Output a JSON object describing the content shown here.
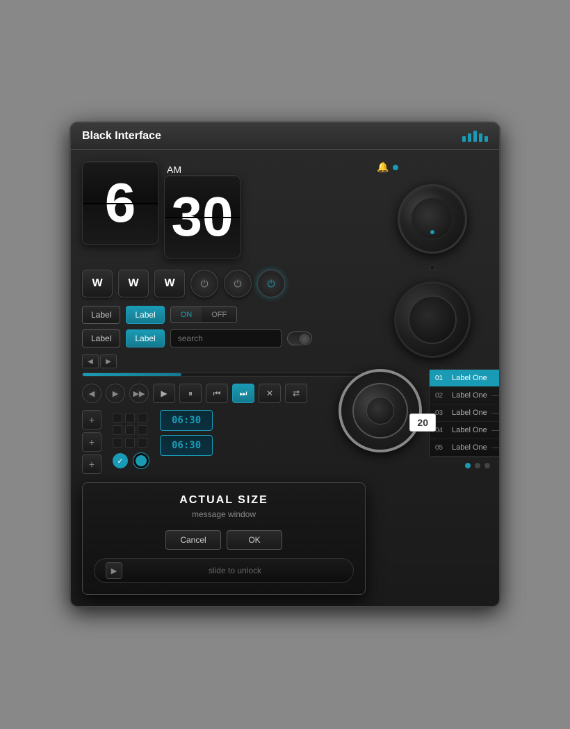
{
  "device": {
    "title": "Black Interface",
    "title_bars": [
      1,
      2,
      3,
      4,
      5
    ]
  },
  "clock": {
    "hour": "6",
    "minute": "30",
    "period": "AM"
  },
  "w_buttons": [
    "W",
    "W",
    "W"
  ],
  "power_buttons": [
    "⏻",
    "⏻",
    "⏻"
  ],
  "labels": {
    "label1": "Label",
    "label2": "Label",
    "label3": "Label",
    "label4": "Label"
  },
  "toggle": {
    "on": "ON",
    "off": "OFF"
  },
  "search": {
    "placeholder": "search"
  },
  "transport": {
    "play": "▶",
    "pause": "⏸",
    "prev": "⏮",
    "next": "⏭",
    "stop": "✕",
    "shuffle": "⇄"
  },
  "modal": {
    "title": "ACTUAL SIZE",
    "subtitle": "message window",
    "cancel": "Cancel",
    "ok": "OK",
    "slide_text": "slide to unlock"
  },
  "time_displays": [
    "06:30",
    "06:30"
  ],
  "list_items": [
    {
      "num": "01",
      "label": "Label One"
    },
    {
      "num": "02",
      "label": "Label One"
    },
    {
      "num": "03",
      "label": "Label One"
    },
    {
      "num": "04",
      "label": "Label One"
    },
    {
      "num": "05",
      "label": "Label One"
    }
  ],
  "value_display": "20",
  "pagination": [
    0,
    1,
    2
  ],
  "colors": {
    "accent": "#1a9bb5",
    "bg_dark": "#111111",
    "bg_medium": "#1a1a1a"
  }
}
